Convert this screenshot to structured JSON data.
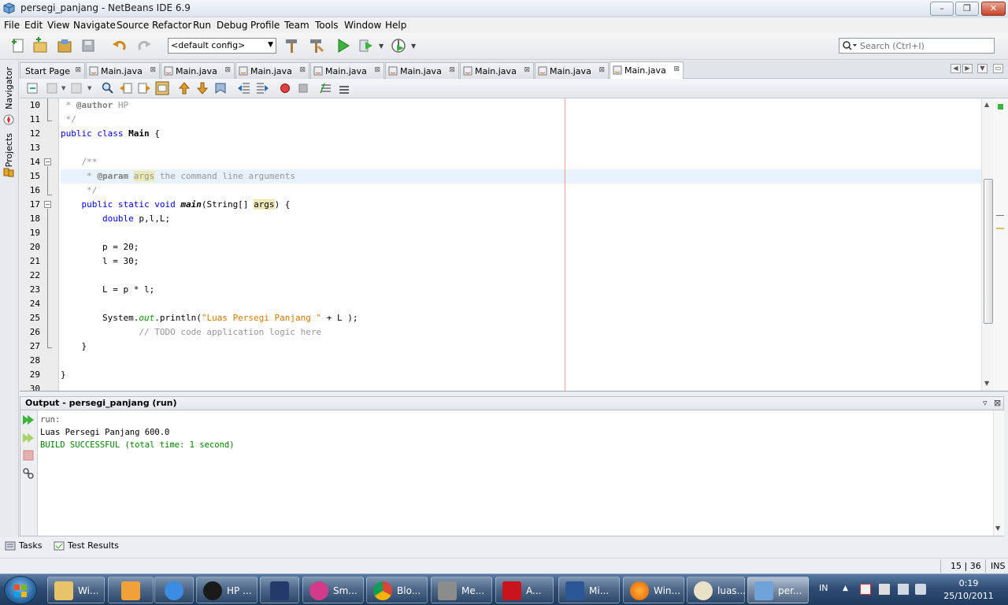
{
  "window": {
    "title": "persegi_panjang - NetBeans IDE 6.9",
    "buttons": [
      "–",
      "❐",
      "✕"
    ]
  },
  "menu": [
    "File",
    "Edit",
    "View",
    "Navigate",
    "Source",
    "Refactor",
    "Run",
    "Debug",
    "Profile",
    "Team",
    "Tools",
    "Window",
    "Help"
  ],
  "toolbar": {
    "config_value": "<default config>",
    "search_placeholder": "Search (Ctrl+I)"
  },
  "siderail": {
    "navigator": "Navigator",
    "projects": "Projects"
  },
  "tabs": [
    {
      "label": "Start Page",
      "active": false
    },
    {
      "label": "Main.java",
      "active": false
    },
    {
      "label": "Main.java",
      "active": false
    },
    {
      "label": "Main.java",
      "active": false
    },
    {
      "label": "Main.java",
      "active": false
    },
    {
      "label": "Main.java",
      "active": false
    },
    {
      "label": "Main.java",
      "active": false
    },
    {
      "label": "Main.java",
      "active": false
    },
    {
      "label": "Main.java",
      "active": true
    }
  ],
  "editor": {
    "line_numbers": [
      "10",
      "11",
      "12",
      "13",
      "14",
      "15",
      "16",
      "17",
      "18",
      "19",
      "20",
      "21",
      "22",
      "23",
      "24",
      "25",
      "26",
      "27",
      "28",
      "29",
      "30"
    ],
    "code": {
      "l10a": " * ",
      "l10b": "@author",
      "l10c": " HP",
      "l11": " */",
      "l12a": "public class ",
      "l12b": "Main",
      "l12c": " {",
      "l14": "    /**",
      "l15a": "     * ",
      "l15b": "@param",
      "l15c": " ",
      "l15d": "args",
      "l15e": " the command line arguments",
      "l16": "     */",
      "l17a": "    public static void ",
      "l17b": "main",
      "l17c": "(String[] ",
      "l17d": "args",
      "l17e": ") {",
      "l18a": "        ",
      "l18b": "double",
      "l18c": " p,l,L;",
      "l20": "        p = 20;",
      "l21": "        l = 30;",
      "l23": "        L = p * l;",
      "l25a": "        System.",
      "l25b": "out",
      "l25c": ".println(",
      "l25d": "\"Luas Persegi Panjang \"",
      "l25e": " + L );",
      "l26": "               // TODO code application logic here",
      "l27": "    }",
      "l29": "}"
    }
  },
  "output": {
    "title": "Output - persegi_panjang (run)",
    "lines": [
      "run:",
      "Luas Persegi Panjang 600.0",
      "BUILD SUCCESSFUL (total time: 1 second)"
    ]
  },
  "bottom_tabs": [
    "Tasks",
    "Test Results"
  ],
  "status": {
    "position": "15 | 36",
    "mode": "INS"
  },
  "taskbar": {
    "items": [
      {
        "label": "Wi..."
      },
      {
        "label": ""
      },
      {
        "label": ""
      },
      {
        "label": "HP ..."
      },
      {
        "label": ""
      },
      {
        "label": "Sm..."
      },
      {
        "label": "Blo..."
      },
      {
        "label": "Me..."
      },
      {
        "label": "A..."
      },
      {
        "label": "Mi..."
      },
      {
        "label": "Win..."
      },
      {
        "label": "luas..."
      },
      {
        "label": "per..."
      }
    ],
    "lang": "IN",
    "time": "0:19",
    "date": "25/10/2011"
  },
  "colors": {
    "keyword": "#0000E6",
    "comment": "#969696",
    "string": "#CE7B00",
    "field": "#009900",
    "build_success": "#008000"
  }
}
